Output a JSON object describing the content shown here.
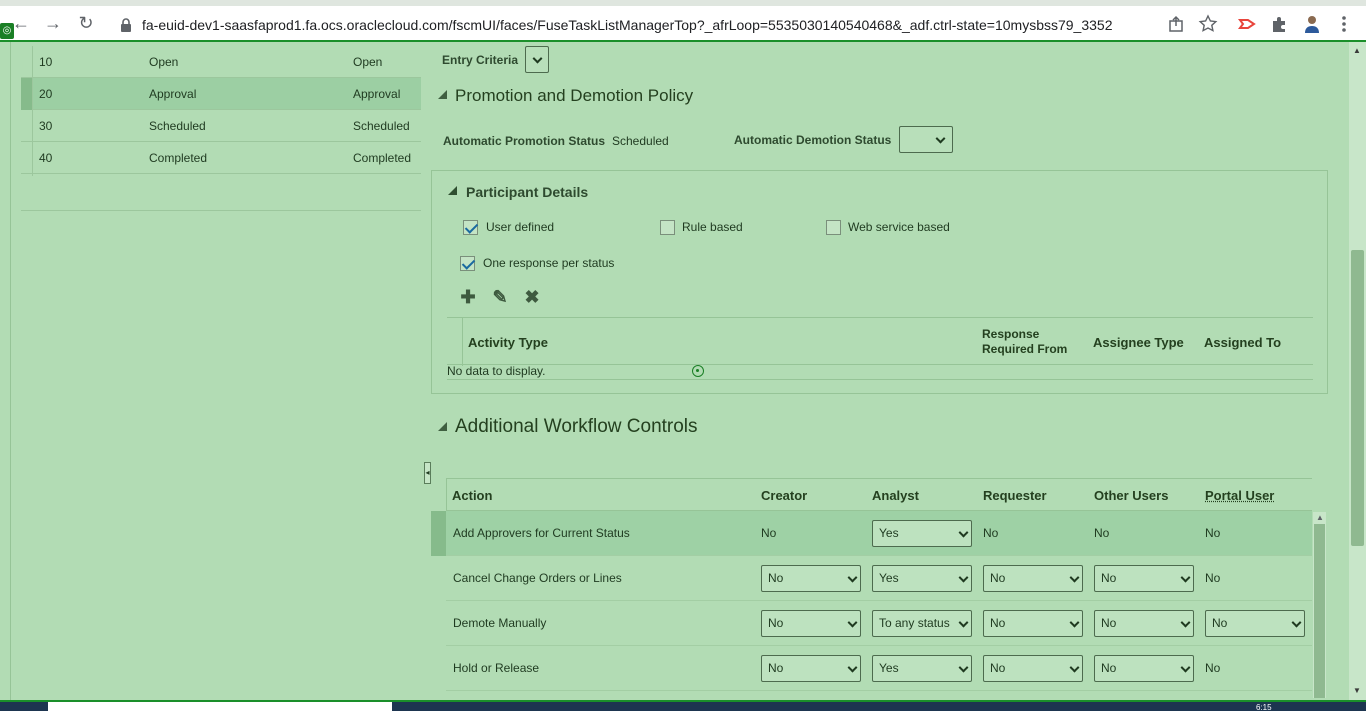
{
  "browser": {
    "url": "fa-euid-dev1-saasfaprod1.fa.ocs.oraclecloud.com/fscmUI/faces/FuseTaskListManagerTop?_afrLoop=5535030140540468&_adf.ctrl-state=10mysbss79_3352",
    "badge": "◎",
    "back_icon": "←",
    "forward_icon": "→",
    "reload_icon": "↻"
  },
  "statuses": [
    {
      "code": "10",
      "name": "Open",
      "display": "Open",
      "selected": false
    },
    {
      "code": "20",
      "name": "Approval",
      "display": "Approval",
      "selected": true
    },
    {
      "code": "30",
      "name": "Scheduled",
      "display": "Scheduled",
      "selected": false
    },
    {
      "code": "40",
      "name": "Completed",
      "display": "Completed",
      "selected": false
    }
  ],
  "entry_criteria": {
    "label": "Entry Criteria"
  },
  "promotion": {
    "title": "Promotion and Demotion Policy",
    "auto_promo_label": "Automatic Promotion Status",
    "auto_promo_value": "Scheduled",
    "auto_demo_label": "Automatic Demotion Status"
  },
  "participants": {
    "title": "Participant Details",
    "user_defined": "User defined",
    "rule_based": "Rule based",
    "web_service_based": "Web service based",
    "one_response": "One response per status",
    "columns": {
      "activity_type": "Activity Type",
      "response_required_1": "Response",
      "response_required_2": "Required From",
      "assignee_type": "Assignee Type",
      "assigned_to": "Assigned To"
    },
    "no_data": "No data to display."
  },
  "workflow": {
    "title": "Additional Workflow Controls",
    "columns": {
      "action": "Action",
      "creator": "Creator",
      "analyst": "Analyst",
      "requester": "Requester",
      "other_users": "Other Users",
      "portal_user": "Portal User"
    },
    "rows": [
      {
        "action": "Add Approvers for Current Status",
        "creator": "No",
        "analyst": "Yes",
        "requester": "No",
        "other_users": "No",
        "portal_user": "No"
      },
      {
        "action": "Cancel Change Orders or Lines",
        "creator": "No",
        "analyst": "Yes",
        "requester": "No",
        "other_users": "No",
        "portal_user": "No"
      },
      {
        "action": "Demote Manually",
        "creator": "No",
        "analyst": "To any status",
        "requester": "No",
        "other_users": "No",
        "portal_user": "No"
      },
      {
        "action": "Hold or Release",
        "creator": "No",
        "analyst": "Yes",
        "requester": "No",
        "other_users": "No",
        "portal_user": "No"
      }
    ]
  },
  "taskbar": {
    "time": "6:15"
  },
  "colors": {
    "page_bg": "#b2dcb4",
    "accent_green": "#1a8f2a",
    "check_blue": "#1a6aa0"
  }
}
